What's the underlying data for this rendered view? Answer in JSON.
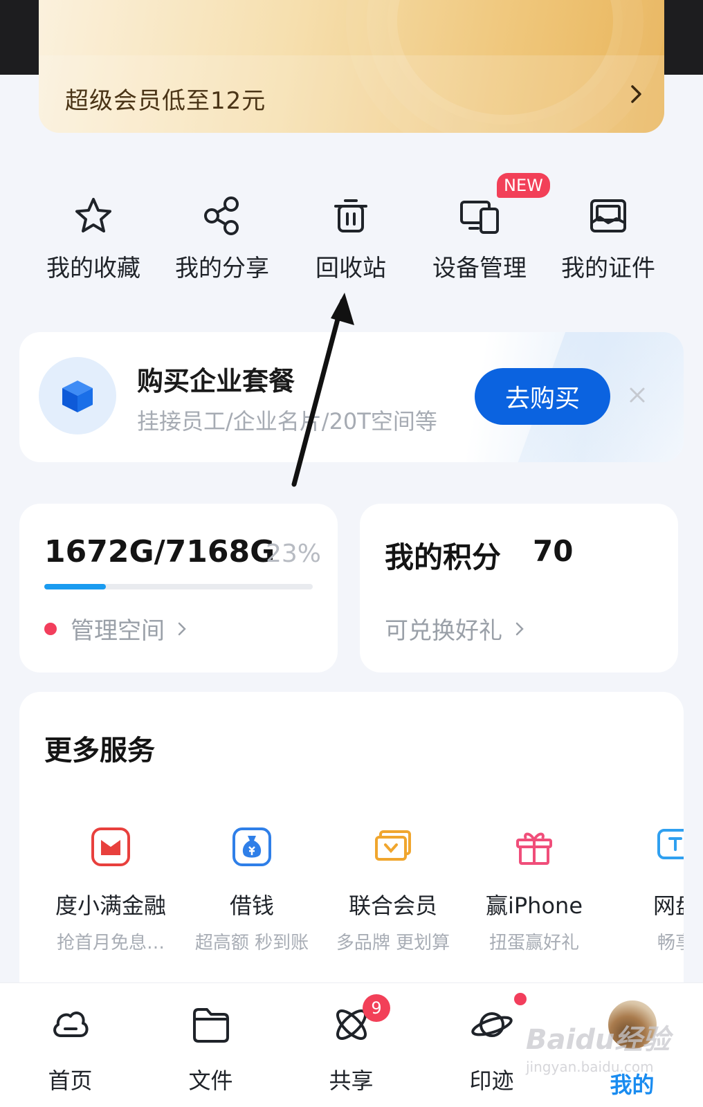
{
  "vip_banner": {
    "text": "超级会员低至12元"
  },
  "quick_actions": [
    {
      "label": "我的收藏",
      "icon": "star-icon"
    },
    {
      "label": "我的分享",
      "icon": "share-icon"
    },
    {
      "label": "回收站",
      "icon": "trash-icon"
    },
    {
      "label": "设备管理",
      "icon": "devices-icon",
      "badge": "NEW"
    },
    {
      "label": "我的证件",
      "icon": "id-card-icon"
    }
  ],
  "business_card": {
    "title": "购买企业套餐",
    "subtitle": "挂接员工/企业名片/20T空间等",
    "button_label": "去购买",
    "icon": "cube-icon"
  },
  "storage": {
    "used": "1672G/7168G",
    "percent_label": "23%",
    "percent_value": 0.23,
    "link_label": "管理空间"
  },
  "points": {
    "title": "我的积分",
    "value": "70",
    "link_label": "可兑换好礼"
  },
  "services": {
    "title": "更多服务",
    "items": [
      {
        "name": "度小满金融",
        "desc": "抢首月免息…",
        "icon": "du-finance-icon"
      },
      {
        "name": "借钱",
        "desc": "超高额 秒到账",
        "icon": "money-bag-icon"
      },
      {
        "name": "联合会员",
        "desc": "多品牌 更划算",
        "icon": "membership-icon"
      },
      {
        "name": "赢iPhone",
        "desc": "扭蛋赢好礼",
        "icon": "gift-icon"
      },
      {
        "name": "网盘",
        "desc": "畅享",
        "icon": "netdisk-icon"
      }
    ]
  },
  "tabbar": {
    "items": [
      {
        "label": "首页",
        "icon": "cloud-icon"
      },
      {
        "label": "文件",
        "icon": "folder-icon"
      },
      {
        "label": "共享",
        "icon": "atom-icon",
        "badge": "9"
      },
      {
        "label": "印迹",
        "icon": "planet-icon",
        "dot": true
      },
      {
        "label": "我的",
        "icon": "avatar",
        "active": true
      }
    ]
  },
  "watermark": {
    "text": "Baidu经验",
    "sub": "jingyan.baidu.com"
  },
  "colors": {
    "primary_blue": "#0b63e0",
    "active_tab": "#1a8cf0",
    "badge_red": "#f24058",
    "progress": "#1a9bf0"
  }
}
